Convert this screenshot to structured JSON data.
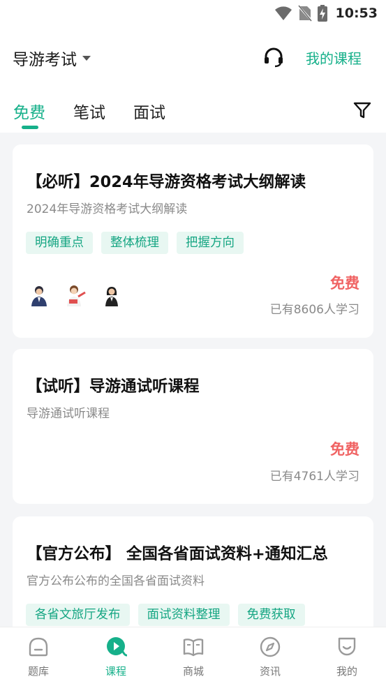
{
  "status_bar": {
    "time": "10:53"
  },
  "header": {
    "exam_name": "导游考试",
    "my_courses_label": "我的课程"
  },
  "tabs": [
    {
      "label": "免费",
      "active": true
    },
    {
      "label": "笔试",
      "active": false
    },
    {
      "label": "面试",
      "active": false
    }
  ],
  "cards": [
    {
      "title": "【必听】2024年导游资格考试大纲解读",
      "subtitle": "2024年导游资格考试大纲解读",
      "tags": [
        "明确重点",
        "整体梳理",
        "把握方向"
      ],
      "price": "免费",
      "learners": "已有8606人学习",
      "teacher_avatars": [
        "teacher-avatar-1",
        "teacher-avatar-2",
        "teacher-avatar-3"
      ]
    },
    {
      "title": "【试听】导游通试听课程",
      "subtitle": "导游通试听课程",
      "tags": [],
      "price": "免费",
      "learners": "已有4761人学习"
    },
    {
      "title": "【官方公布】 全国各省面试资料+通知汇总",
      "subtitle": "官方公布公布的全国各省面试资料",
      "tags": [
        "各省文旅厅发布",
        "面试资料整理",
        "免费获取"
      ]
    }
  ],
  "bottom_nav": [
    {
      "label": "题库",
      "icon": "question-bank-icon",
      "active": false
    },
    {
      "label": "课程",
      "icon": "play-course-icon",
      "active": true
    },
    {
      "label": "商城",
      "icon": "book-mall-icon",
      "active": false
    },
    {
      "label": "资讯",
      "icon": "compass-news-icon",
      "active": false
    },
    {
      "label": "我的",
      "icon": "smile-profile-icon",
      "active": false
    }
  ],
  "colors": {
    "accent": "#16b08a",
    "price": "#f06363",
    "tag_bg": "#e8f7f2",
    "page_bg": "#f4f5f7"
  }
}
